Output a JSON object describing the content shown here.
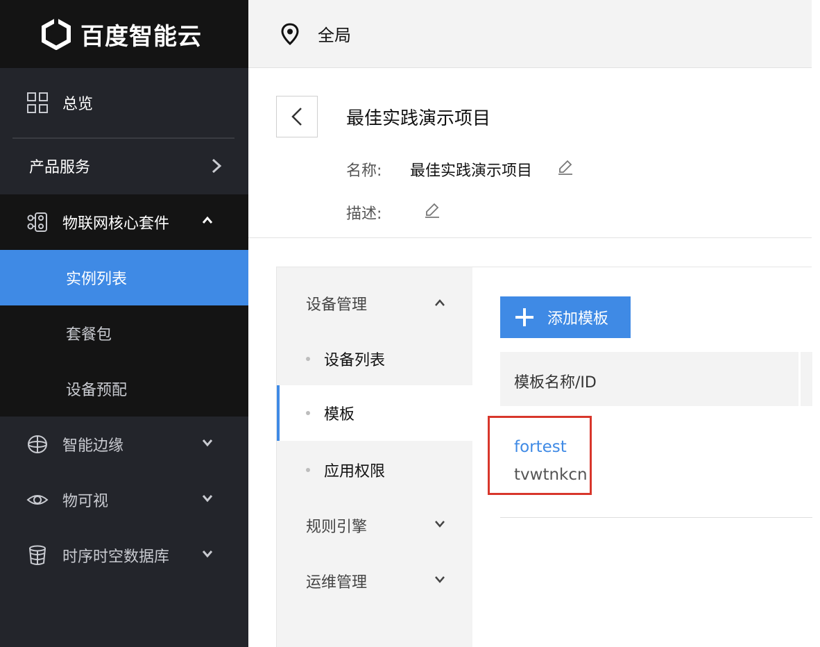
{
  "brand": {
    "name": "百度智能云"
  },
  "topbar": {
    "region": "全局",
    "region_icon": "location-pin-icon"
  },
  "sidebar": {
    "overview": "总览",
    "products": "产品服务",
    "group": {
      "label": "物联网核心套件",
      "items": [
        "实例列表",
        "套餐包",
        "设备预配"
      ],
      "active": "实例列表"
    },
    "items": [
      {
        "label": "智能边缘",
        "icon": "edge-icon"
      },
      {
        "label": "物可视",
        "icon": "eye-icon"
      },
      {
        "label": "时序时空数据库",
        "icon": "database-icon"
      }
    ]
  },
  "project": {
    "title": "最佳实践演示项目",
    "name_label": "名称:",
    "name_value": "最佳实践演示项目",
    "desc_label": "描述:"
  },
  "subnav": {
    "device_mgmt": "设备管理",
    "items": [
      "设备列表",
      "模板",
      "应用权限"
    ],
    "active": "模板",
    "rule_engine": "规则引擎",
    "ops_mgmt": "运维管理"
  },
  "content": {
    "add_button": "添加模板",
    "table": {
      "columns": [
        "模板名称/ID"
      ],
      "rows": [
        {
          "name": "fortest",
          "id": "tvwtnkcn"
        }
      ]
    }
  },
  "colors": {
    "accent": "#3f8ae5",
    "sidebar_bg": "#23252b",
    "sidebar_dark": "#141414",
    "highlight": "#d8362b"
  }
}
